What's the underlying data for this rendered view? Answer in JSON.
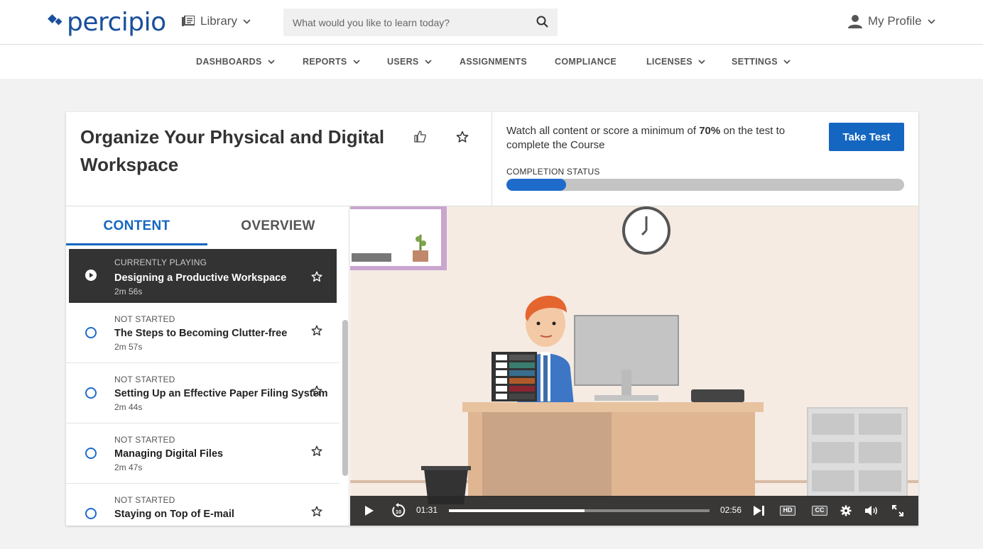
{
  "header": {
    "logo_text": "percipio",
    "library_label": "Library",
    "search_placeholder": "What would you like to learn today?",
    "profile_label": "My Profile"
  },
  "nav": {
    "items": [
      {
        "label": "DASHBOARDS",
        "dropdown": true
      },
      {
        "label": "REPORTS",
        "dropdown": true
      },
      {
        "label": "USERS",
        "dropdown": true
      },
      {
        "label": "ASSIGNMENTS",
        "dropdown": false
      },
      {
        "label": "COMPLIANCE",
        "dropdown": false
      },
      {
        "label": "LICENSES",
        "dropdown": true
      },
      {
        "label": "SETTINGS",
        "dropdown": true
      }
    ]
  },
  "course": {
    "title": "Organize Your Physical and Digital Workspace",
    "status_prefix": "Watch all content or score a minimum of ",
    "status_threshold": "70%",
    "status_suffix": " on the test to complete the Course",
    "take_test_label": "Take Test",
    "completion_label": "COMPLETION STATUS",
    "completion_fraction": 0.15
  },
  "tabs": {
    "content": "CONTENT",
    "overview": "OVERVIEW"
  },
  "items": [
    {
      "status": "CURRENTLY PLAYING",
      "name": "Designing a Productive Workspace",
      "duration": "2m 56s"
    },
    {
      "status": "NOT STARTED",
      "name": "The Steps to Becoming Clutter-free",
      "duration": "2m 57s"
    },
    {
      "status": "NOT STARTED",
      "name": "Setting Up an Effective Paper Filing System",
      "duration": "2m 44s"
    },
    {
      "status": "NOT STARTED",
      "name": "Managing Digital Files",
      "duration": "2m 47s"
    },
    {
      "status": "NOT STARTED",
      "name": "Staying on Top of E-mail",
      "duration": ""
    }
  ],
  "player": {
    "current_time": "01:31",
    "total_time": "02:56",
    "played_fraction": 0.52,
    "hd_label": "HD",
    "cc_label": "CC",
    "rewind_label": "10"
  },
  "colors": {
    "brand": "#1a4f9c",
    "accent": "#1566c0",
    "progress": "#1e6bcc"
  }
}
